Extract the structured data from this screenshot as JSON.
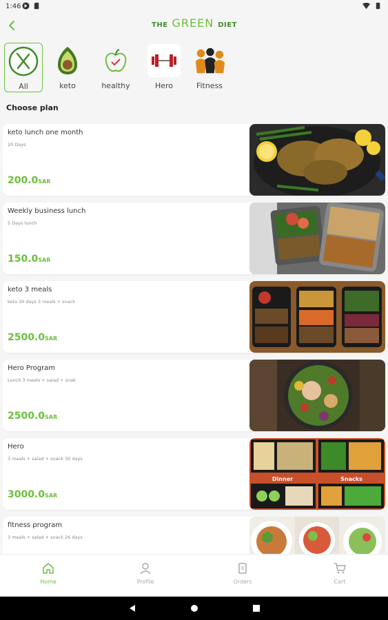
{
  "status_bar": {
    "time": "1:46"
  },
  "header": {
    "logo_left": "THE",
    "logo_center": "GREEN",
    "logo_right": "DIET",
    "back_icon": "chevron-left-icon"
  },
  "categories": [
    {
      "label": "All",
      "icon": "fork-knife-icon",
      "selected": true
    },
    {
      "label": "keto",
      "icon": "avocado-icon",
      "selected": false
    },
    {
      "label": "healthy",
      "icon": "apple-icon",
      "selected": false
    },
    {
      "label": "Hero",
      "icon": "dumbbell-icon",
      "selected": false
    },
    {
      "label": "Fitness",
      "icon": "fitness-people-icon",
      "selected": false
    }
  ],
  "section_title": "Choose plan",
  "plans": [
    {
      "name": "keto lunch one month",
      "desc": "20 Days",
      "price": "200.0",
      "currency": "SAR"
    },
    {
      "name": "Weekly business lunch",
      "desc": "5 Days lunch",
      "price": "150.0",
      "currency": "SAR"
    },
    {
      "name": "keto 3 meals",
      "desc": "keto 30 days 3 meals + snack",
      "price": "2500.0",
      "currency": "SAR"
    },
    {
      "name": "Hero Program",
      "desc": "Lunch 3 meals + salad + snak",
      "price": "2500.0",
      "currency": "SAR"
    },
    {
      "name": "Hero",
      "desc": "3 meals + salad + snack 30 days",
      "price": "3000.0",
      "currency": "SAR"
    },
    {
      "name": "fitness program",
      "desc": "3 meals + salad + snack 26 days",
      "price": "",
      "currency": ""
    }
  ],
  "plan_image_labels": {
    "dinner": "Dinner",
    "snacks": "Snacks"
  },
  "bottom_nav": [
    {
      "label": "Home",
      "icon": "home-icon",
      "active": true
    },
    {
      "label": "Profile",
      "icon": "profile-icon",
      "active": false
    },
    {
      "label": "Orders",
      "icon": "orders-icon",
      "active": false
    },
    {
      "label": "Cart",
      "icon": "cart-icon",
      "active": false
    }
  ],
  "colors": {
    "accent": "#6cbf3b",
    "accent_dark": "#3f8a2a"
  }
}
